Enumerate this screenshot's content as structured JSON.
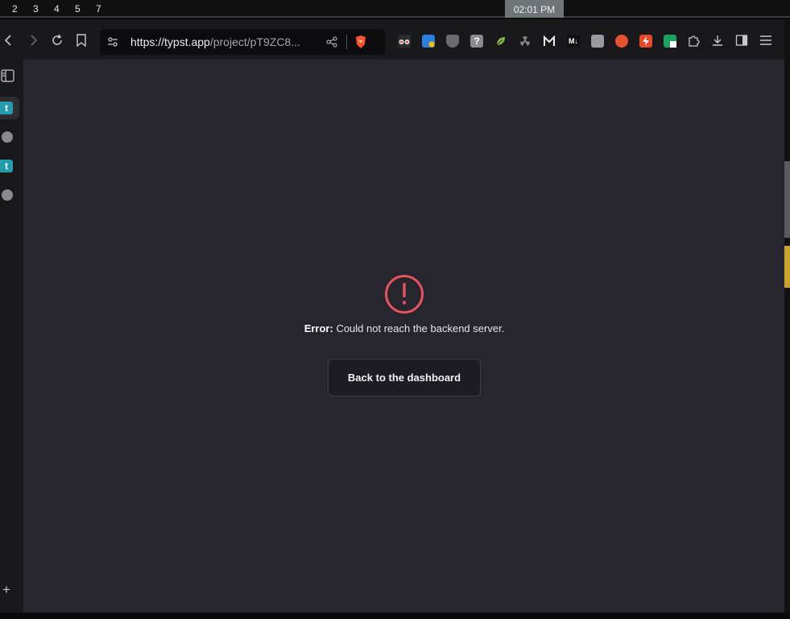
{
  "system_bar": {
    "workspaces": [
      "2",
      "3",
      "4",
      "5",
      "7"
    ],
    "clock": "02:01 PM"
  },
  "browser": {
    "url_host": "https://typst.app",
    "url_path": "/project/pT9ZC8...",
    "extension_badge": "0",
    "toolbar_icons": [
      "back-icon",
      "forward-icon",
      "reload-icon",
      "bookmark-icon",
      "site-settings-icon",
      "share-icon",
      "brave-shield-icon",
      "sidebar-toggle-icon",
      "downloads-icon",
      "menu-icon"
    ]
  },
  "sidebar": {
    "tabs": [
      {
        "icon": "t",
        "kind": "typst"
      },
      {
        "icon": "globe-icon",
        "kind": "web"
      },
      {
        "icon": "t",
        "kind": "typst"
      },
      {
        "icon": "globe-icon",
        "kind": "web"
      }
    ],
    "add_label": "+"
  },
  "page": {
    "error_label": "Error:",
    "error_message": " Could not reach the backend server.",
    "back_button_label": "Back to the dashboard"
  },
  "colors": {
    "error_red": "#e5545b",
    "typst_teal": "#239dad",
    "background": "#27262e"
  }
}
